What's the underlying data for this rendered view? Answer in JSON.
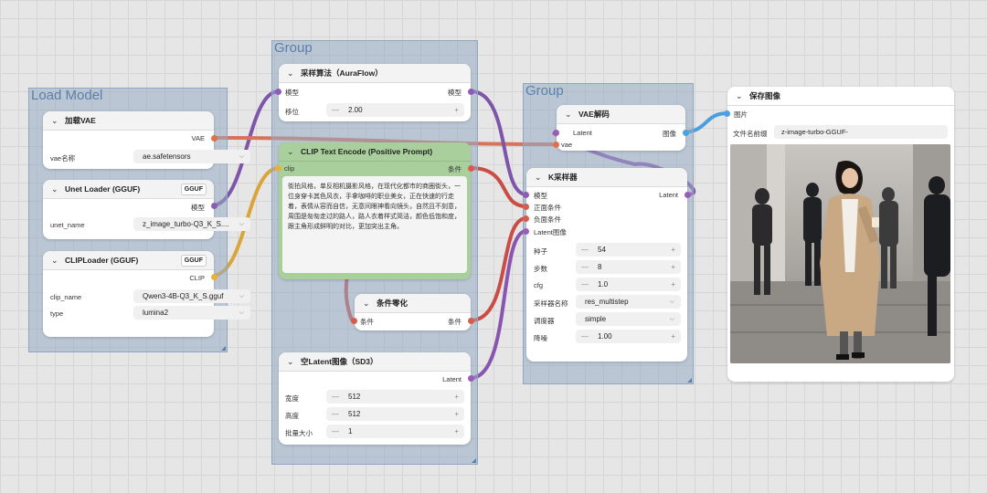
{
  "groups": [
    {
      "title": "Load Model"
    },
    {
      "title": "Group"
    },
    {
      "title": "Group"
    }
  ],
  "vae_loader": {
    "title": "加载VAE",
    "out": "VAE",
    "field_label": "vae名称",
    "field_value": "ae.safetensors"
  },
  "unet_loader": {
    "title": "Unet Loader (GGUF)",
    "badge": "GGUF",
    "out": "模型",
    "field_label": "unet_name",
    "field_value": "z_image_turbo-Q3_K_S...."
  },
  "clip_loader": {
    "title": "CLIPLoader (GGUF)",
    "badge": "GGUF",
    "out": "CLIP",
    "field1_label": "clip_name",
    "field1_value": "Qwen3-4B-Q3_K_S.gguf",
    "field2_label": "type",
    "field2_value": "lumina2"
  },
  "sampling": {
    "title": "采样算法（AuraFlow）",
    "in": "模型",
    "out": "模型",
    "field_label": "移位",
    "field_value": "2.00"
  },
  "clip_encode": {
    "title": "CLIP Text Encode (Positive Prompt)",
    "in": "clip",
    "out": "条件",
    "prompt": "街拍风格，单反相机摄影风格，在现代化都市的商圈街头，一位身穿卡其色风衣，手拿咖啡的职业美女，正在快速的行走着，表情从容而自信，无意间眼神看向镜头，自然且不刻意，周围是匆匆走过的路人，路人衣着样式简洁，颜色低饱和度，跟主角形成鲜明的对比，更加突出主角。"
  },
  "zero_cond": {
    "title": "条件零化",
    "in": "条件",
    "out": "条件"
  },
  "empty_latent": {
    "title": "空Latent图像（SD3）",
    "out": "Latent",
    "width_label": "宽度",
    "width": "512",
    "height_label": "高度",
    "height": "512",
    "batch_label": "批量大小",
    "batch": "1"
  },
  "vae_decode": {
    "title": "VAE解码",
    "in1": "Latent",
    "in2": "vae",
    "out": "图像"
  },
  "ksampler": {
    "title": "K采样器",
    "in1": "模型",
    "in2": "正面条件",
    "in3": "负面条件",
    "in4": "Latent图像",
    "out": "Latent",
    "seed_label": "种子",
    "seed": "54",
    "steps_label": "步数",
    "steps": "8",
    "cfg_label": "cfg",
    "cfg": "1.0",
    "sampler_label": "采样器名称",
    "sampler": "res_multistep",
    "scheduler_label": "调度器",
    "scheduler": "simple",
    "denoise_label": "降噪",
    "denoise": "1.00"
  },
  "save_image": {
    "title": "保存图像",
    "in": "图片",
    "prefix_label": "文件名前缀",
    "prefix": "z-image-turbo-GGUF-"
  },
  "colors": {
    "model": "#8e5bb5",
    "vae": "#e0704a",
    "clip": "#e8b23a",
    "cond": "#d85c4c",
    "latent": "#9a5cb4",
    "image": "#4aa3e0"
  }
}
